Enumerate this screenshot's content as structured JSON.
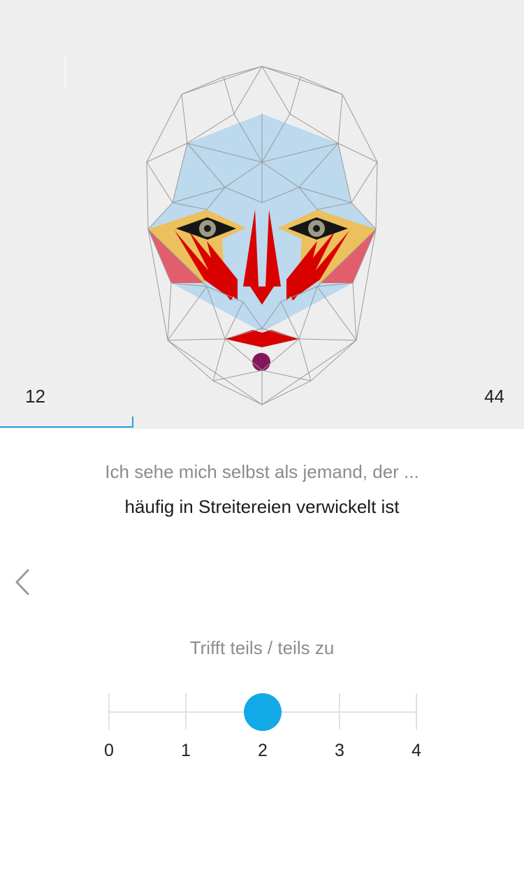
{
  "progress": {
    "current": "12",
    "total": "44",
    "fraction": 0.2545
  },
  "question": {
    "prompt": "Ich sehe mich selbst als jemand, der ...",
    "statement": "häufig in Streitereien verwickelt ist"
  },
  "navigation": {
    "back_icon": "chevron-left-icon"
  },
  "answer": {
    "label": "Trifft teils / teils zu",
    "selected": 2,
    "scale": [
      "0",
      "1",
      "2",
      "3",
      "4"
    ]
  },
  "colors": {
    "accent": "#12a9e6",
    "hero_background": "#eeeeee",
    "face_blue": "#bcd9ee",
    "face_yellow": "#ecc05c",
    "face_pink": "#e35e6c",
    "face_red": "#d90000",
    "chin_dot": "#86165a"
  }
}
